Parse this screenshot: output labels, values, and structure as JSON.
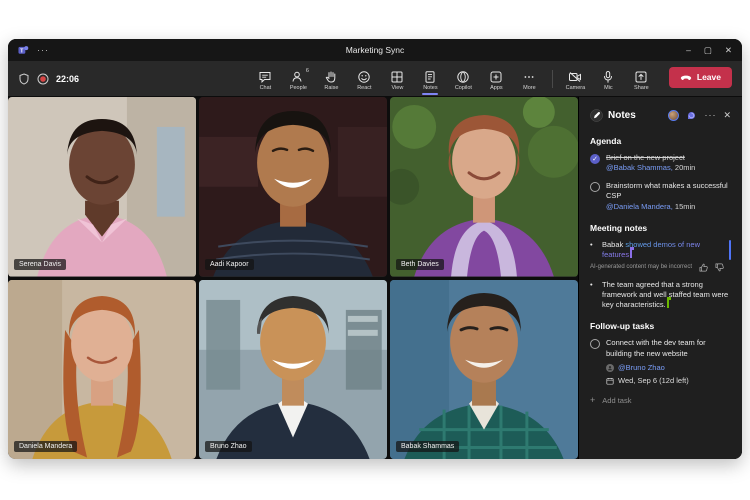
{
  "window": {
    "title": "Marketing Sync",
    "menu_dots": "···",
    "controls": {
      "minimize": "–",
      "maximize": "▢",
      "close": "✕"
    }
  },
  "toolbar": {
    "timer": "22:06",
    "items": [
      {
        "label": "Chat"
      },
      {
        "label": "People",
        "badge": "6"
      },
      {
        "label": "Raise"
      },
      {
        "label": "React"
      },
      {
        "label": "View"
      },
      {
        "label": "Notes",
        "active": true
      },
      {
        "label": "Copilot"
      },
      {
        "label": "Apps"
      },
      {
        "label": "More"
      }
    ],
    "device_items": [
      {
        "label": "Camera"
      },
      {
        "label": "Mic"
      },
      {
        "label": "Share"
      }
    ],
    "leave_label": "Leave"
  },
  "participants": [
    {
      "name": "Serena Davis"
    },
    {
      "name": "Aadi Kapoor"
    },
    {
      "name": "Beth Davies"
    },
    {
      "name": "Daniela Mandera"
    },
    {
      "name": "Bruno Zhao"
    },
    {
      "name": "Babak Shammas"
    }
  ],
  "notes_panel": {
    "title": "Notes",
    "more": "···",
    "close": "✕",
    "agenda": {
      "heading": "Agenda",
      "items": [
        {
          "text": "Brief on the new project",
          "mention": "@Babak Shammas,",
          "duration": "20min",
          "done": true
        },
        {
          "text": "Brainstorm what makes a successful CSP",
          "mention": "@Daniela Mandera,",
          "duration": "15min",
          "done": false
        }
      ]
    },
    "meeting_notes": {
      "heading": "Meeting notes",
      "note1_lead": "Babak ",
      "note1_ai_text": "showed demos of new features",
      "ai_disclaimer": "AI-generated content may be incorrect",
      "note2_text": "The team agreed that a strong framework and well staffed team were key characteristics."
    },
    "followup": {
      "heading": "Follow-up tasks",
      "task_text": "Connect with the dev team for building the new website",
      "assignee": "@Bruno Zhao",
      "due": "Wed, Sep 6 (12d left)",
      "add_task": "Add task",
      "add_plus": "+"
    }
  },
  "colors": {
    "accent_purple": "#5b5fc7",
    "mention_blue": "#7a9df7",
    "leave_red": "#c4314b",
    "record_red": "#d74646",
    "ai_gradient_start": "#5aa7f0",
    "ai_gradient_end": "#9277f2",
    "cursor_green": "#6bb700",
    "cursor_purple": "#8b6fe8"
  }
}
